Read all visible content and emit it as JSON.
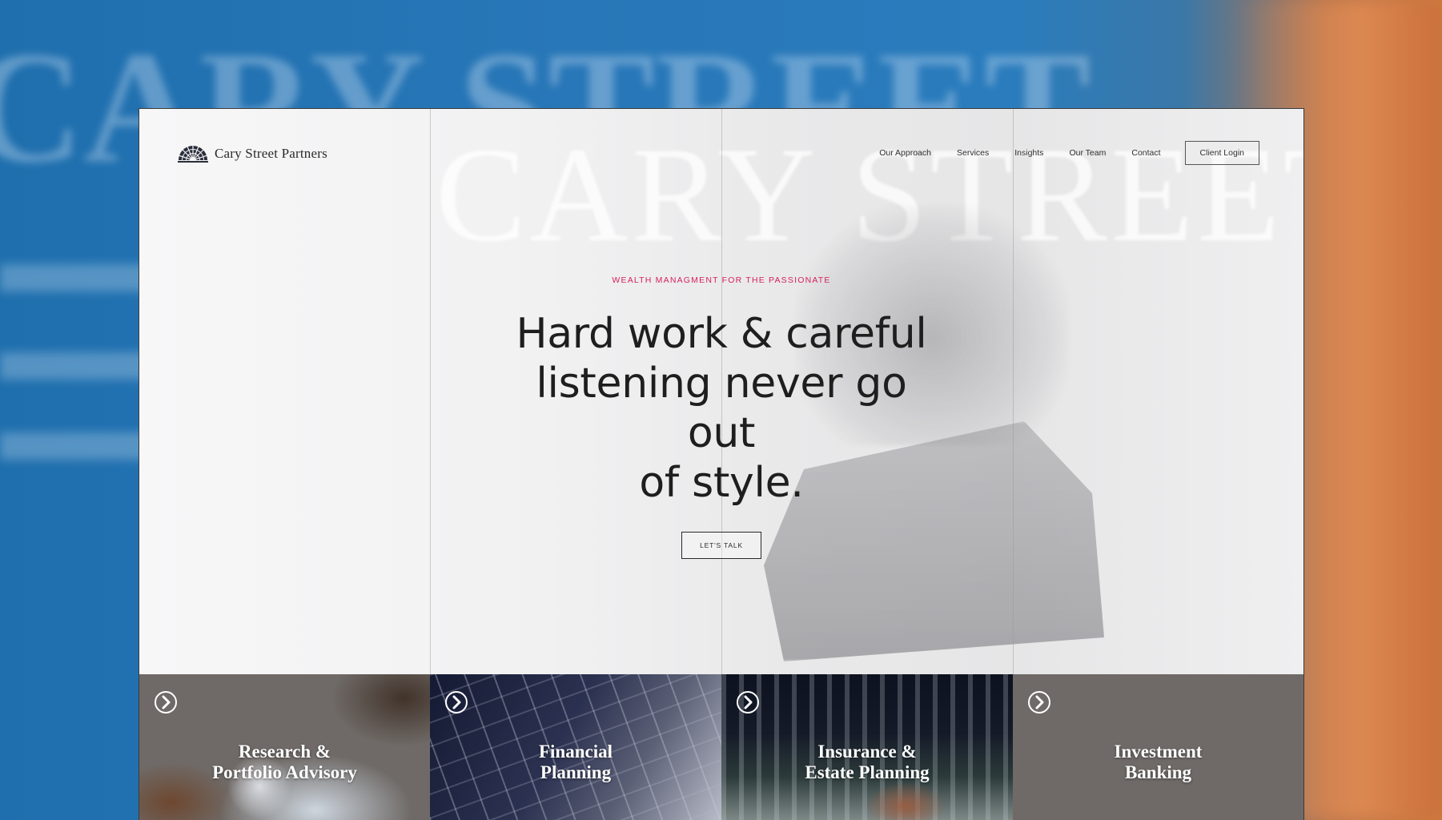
{
  "brand": {
    "name": "Cary Street Partners",
    "logo_icon": "rising-sun-icon"
  },
  "nav": {
    "items": [
      {
        "label": "Our Approach"
      },
      {
        "label": "Services"
      },
      {
        "label": "Insights"
      },
      {
        "label": "Our Team"
      },
      {
        "label": "Contact"
      }
    ],
    "login_label": "Client Login"
  },
  "hero": {
    "background_word": "CARY STREET",
    "eyebrow": "WEALTH MANAGMENT FOR THE PASSIONATE",
    "headline_lines": [
      "Hard work & careful",
      "listening never go out",
      "of style."
    ],
    "cta_label": "LET'S TALK"
  },
  "cards": [
    {
      "title_lines": [
        "Research &",
        "Portfolio Advisory"
      ],
      "icon": "chevron-circle-right-icon"
    },
    {
      "title_lines": [
        "Financial",
        "Planning"
      ],
      "icon": "chevron-circle-right-icon"
    },
    {
      "title_lines": [
        "Insurance &",
        "Estate Planning"
      ],
      "icon": "chevron-circle-right-icon"
    },
    {
      "title_lines": [
        "Investment",
        "Banking"
      ],
      "icon": "chevron-circle-right-icon"
    }
  ],
  "colors": {
    "accent": "#d6215b",
    "text_dark": "#1e1e1e",
    "card_gray": "#6f6a67",
    "card_navy": "#141726"
  }
}
